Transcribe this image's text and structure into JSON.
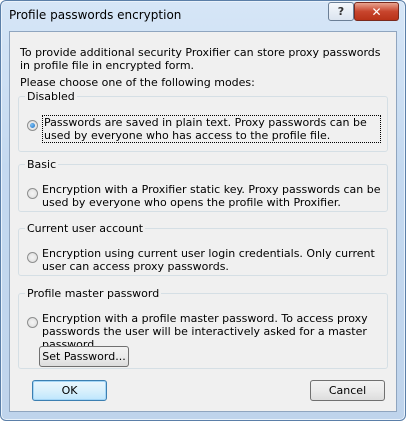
{
  "window": {
    "title": "Profile passwords encryption",
    "help_glyph": "?",
    "close_glyph": "✕"
  },
  "intro": "To provide additional security Proxifier can store proxy passwords in profile file in encrypted form.",
  "choose_prompt": "Please choose one of the following modes:",
  "groups": [
    {
      "legend": "Disabled",
      "option": "Passwords are saved in plain text. Proxy passwords can be used by everyone who has access to the profile file.",
      "selected": true
    },
    {
      "legend": "Basic",
      "option": "Encryption with a Proxifier static key. Proxy passwords can be used by everyone who opens the profile with Proxifier.",
      "selected": false
    },
    {
      "legend": "Current user account",
      "option": "Encryption using current user login credentials. Only current user can access proxy passwords.",
      "selected": false
    },
    {
      "legend": "Profile master password",
      "option": "Encryption with a profile master password. To access proxy passwords the user will be interactively asked for a master password.",
      "selected": false,
      "button": "Set Password..."
    }
  ],
  "buttons": {
    "ok": "OK",
    "cancel": "Cancel"
  }
}
